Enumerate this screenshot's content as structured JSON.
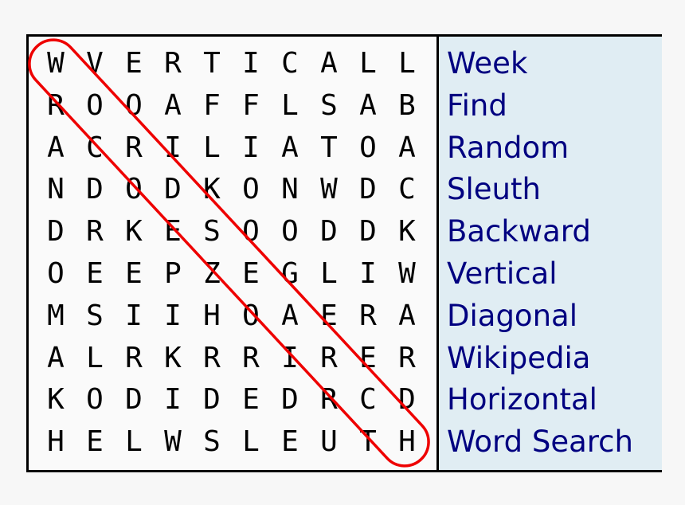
{
  "grid": [
    [
      "W",
      "V",
      "E",
      "R",
      "T",
      "I",
      "C",
      "A",
      "L",
      "L"
    ],
    [
      "R",
      "O",
      "O",
      "A",
      "F",
      "F",
      "L",
      "S",
      "A",
      "B"
    ],
    [
      "A",
      "C",
      "R",
      "I",
      "L",
      "I",
      "A",
      "T",
      "O",
      "A"
    ],
    [
      "N",
      "D",
      "O",
      "D",
      "K",
      "O",
      "N",
      "W",
      "D",
      "C"
    ],
    [
      "D",
      "R",
      "K",
      "E",
      "S",
      "O",
      "O",
      "D",
      "D",
      "K"
    ],
    [
      "O",
      "E",
      "E",
      "P",
      "Z",
      "E",
      "G",
      "L",
      "I",
      "W"
    ],
    [
      "M",
      "S",
      "I",
      "I",
      "H",
      "O",
      "A",
      "E",
      "R",
      "A"
    ],
    [
      "A",
      "L",
      "R",
      "K",
      "R",
      "R",
      "I",
      "R",
      "E",
      "R"
    ],
    [
      "K",
      "O",
      "D",
      "I",
      "D",
      "E",
      "D",
      "R",
      "C",
      "D"
    ],
    [
      "H",
      "E",
      "L",
      "W",
      "S",
      "L",
      "E",
      "U",
      "T",
      "H"
    ]
  ],
  "words": [
    "Week",
    "Find",
    "Random",
    "Sleuth",
    "Backward",
    "Vertical",
    "Diagonal",
    "Wikipedia",
    "Horizontal",
    "Word Search"
  ],
  "highlighted_word": {
    "text": "Word Search",
    "from": [
      0,
      0
    ],
    "to": [
      9,
      9
    ],
    "direction": "diagonal"
  },
  "colors": {
    "highlight": "#ee0000",
    "word_text": "#000080",
    "word_panel_bg": "#e0edf3",
    "grid_bg": "#fafafa"
  }
}
